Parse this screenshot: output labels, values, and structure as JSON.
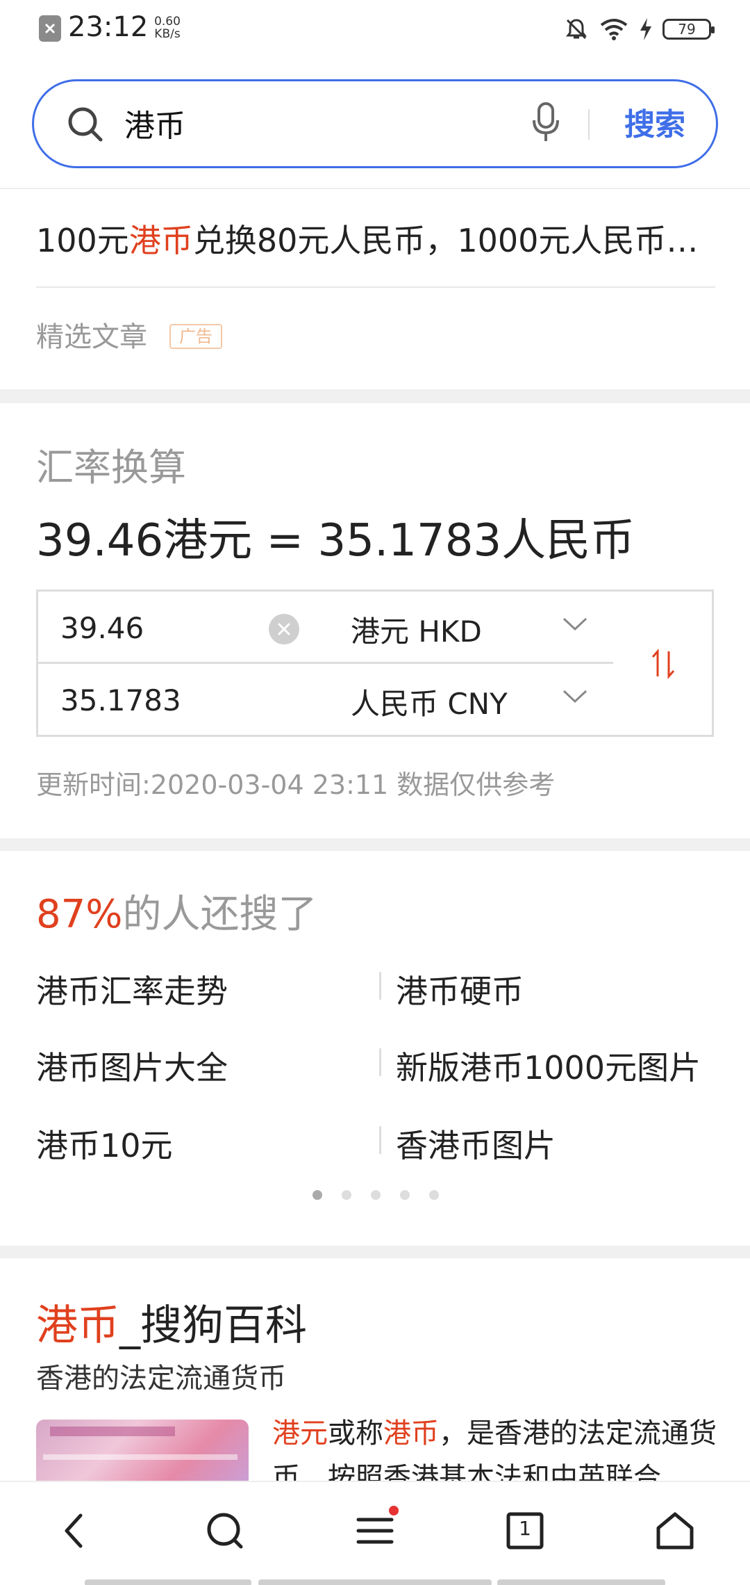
{
  "status_bar": {
    "time": "23:12",
    "speed_value": "0.60",
    "speed_unit": "KB/s",
    "battery": "79",
    "icons": [
      "notification-icon",
      "mute-bell-icon",
      "wifi-icon",
      "charging-icon",
      "battery-icon"
    ]
  },
  "search": {
    "query": "港币",
    "button_label": "搜索"
  },
  "top_result": {
    "text_pre": "100元",
    "text_highlight": "港币",
    "text_post": "兑换80元人民币，1000元人民币…",
    "featured_label": "精选文章",
    "ad_tag": "广告"
  },
  "fx": {
    "title": "汇率换算",
    "result": "39.46港元 = 35.1783人民币",
    "from_amount": "39.46",
    "to_amount": "35.1783",
    "from_currency": "港元 HKD",
    "to_currency": "人民币 CNY",
    "updated": "更新时间:2020-03-04 23:11 数据仅供参考"
  },
  "also_searched": {
    "percent": "87%",
    "label": "的人还搜了",
    "items": [
      "港币汇率走势",
      "港币硬币",
      "港币图片大全",
      "新版港币1000元图片",
      "港币10元",
      "香港币图片"
    ],
    "pages": 5,
    "active_page": 0
  },
  "wiki": {
    "title_highlight": "港币",
    "title_rest": "_搜狗百科",
    "subtitle": "香港的法定流通货币",
    "desc_hl1": "港元",
    "desc_mid": "或称",
    "desc_hl2": "港币",
    "desc_rest": "，是香港的法定流通货币，按照香港基本法和中英联合"
  },
  "bottom_nav": {
    "tab_count": "1",
    "items": [
      "back-icon",
      "search-icon",
      "menu-icon",
      "tabs-icon",
      "home-icon"
    ]
  },
  "colors": {
    "accent_blue": "#3f6ee8",
    "highlight_red": "#e0401e"
  }
}
